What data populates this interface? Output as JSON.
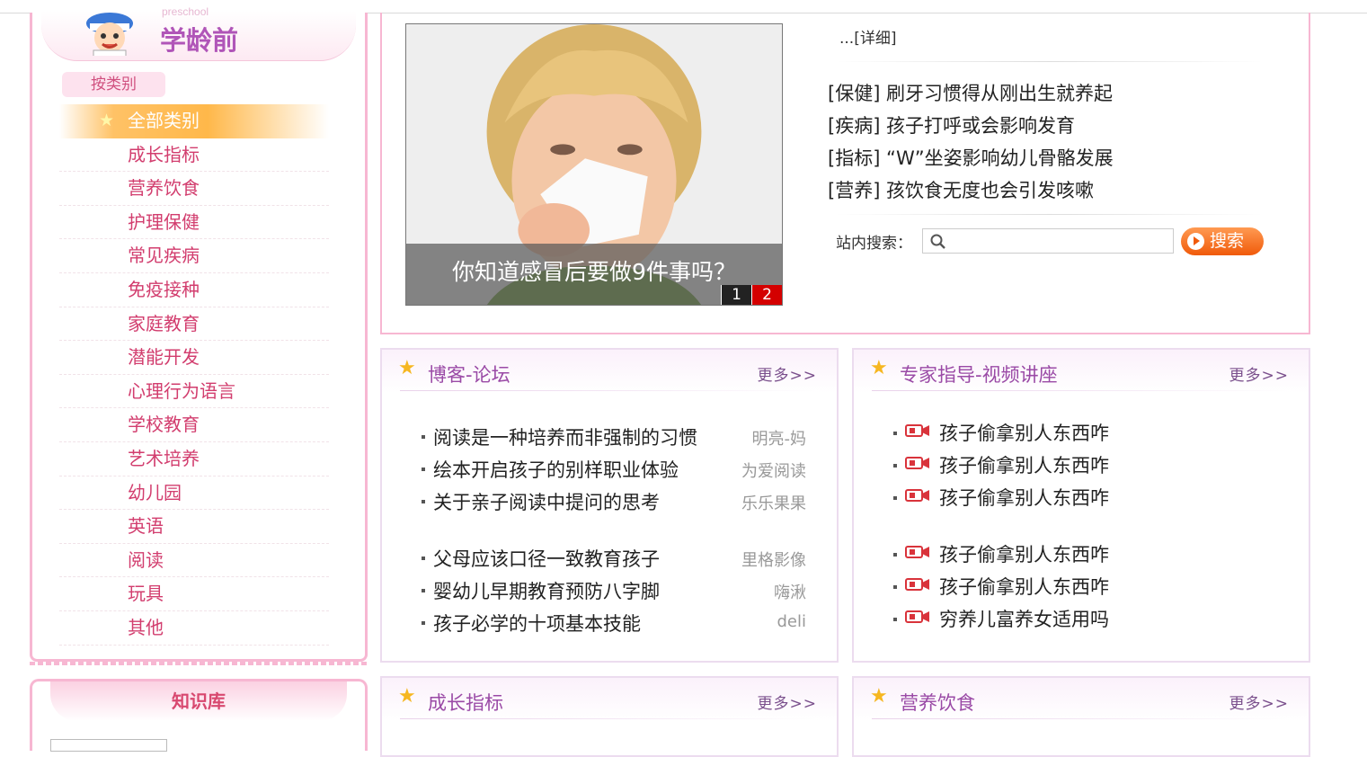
{
  "colors": {
    "accent_pink": "#f7b7d2",
    "category_red": "#d23d6e",
    "active_orange": "#ffb84a",
    "search_orange": "#f05a0a",
    "title_purple": "#9a4aa6"
  },
  "logo": {
    "sub": "preschool",
    "title": "学龄前"
  },
  "sidebar": {
    "tab": "按类别",
    "active": "全部类别",
    "items": [
      "成长指标",
      "营养饮食",
      "护理保健",
      "常见疾病",
      "免疫接种",
      "家庭教育",
      "潜能开发",
      "心理行为语言",
      "学校教育",
      "艺术培养",
      "幼儿园",
      "英语",
      "阅读",
      "玩具",
      "其他"
    ]
  },
  "knowledge": {
    "title": "知识库"
  },
  "feature": {
    "caption": "你知道感冒后要做9件事吗？",
    "pages": [
      "1",
      "2"
    ],
    "detail": "...[详细]",
    "news": [
      "[保健] 刷牙习惯得从刚出生就养起",
      "[疾病] 孩子打呼或会影响发育",
      "[指标] “W”坐姿影响幼儿骨骼发展",
      "[营养] 孩饮食无度也会引发咳嗽"
    ],
    "search_label": "站内搜索：",
    "search_button": "搜索"
  },
  "more": "更多>>",
  "boxes": {
    "blog": {
      "title": "博客-论坛",
      "group1": [
        {
          "title": "阅读是一种培养而非强制的习惯",
          "author": "明亮-妈"
        },
        {
          "title": "绘本开启孩子的别样职业体验",
          "author": "为爱阅读"
        },
        {
          "title": "关于亲子阅读中提问的思考",
          "author": "乐乐果果"
        }
      ],
      "group2": [
        {
          "title": "父母应该口径一致教育孩子",
          "author": "里格影像"
        },
        {
          "title": "婴幼儿早期教育预防八字脚",
          "author": "嗨湫"
        },
        {
          "title": "孩子必学的十项基本技能",
          "author": "deli"
        }
      ]
    },
    "video": {
      "title": "专家指导-视频讲座",
      "group1": [
        "孩子偷拿别人东西咋",
        "孩子偷拿别人东西咋",
        "孩子偷拿别人东西咋"
      ],
      "group2": [
        "孩子偷拿别人东西咋",
        "孩子偷拿别人东西咋",
        "穷养儿富养女适用吗"
      ]
    },
    "growth": {
      "title": "成长指标"
    },
    "nutrition": {
      "title": "营养饮食"
    }
  }
}
